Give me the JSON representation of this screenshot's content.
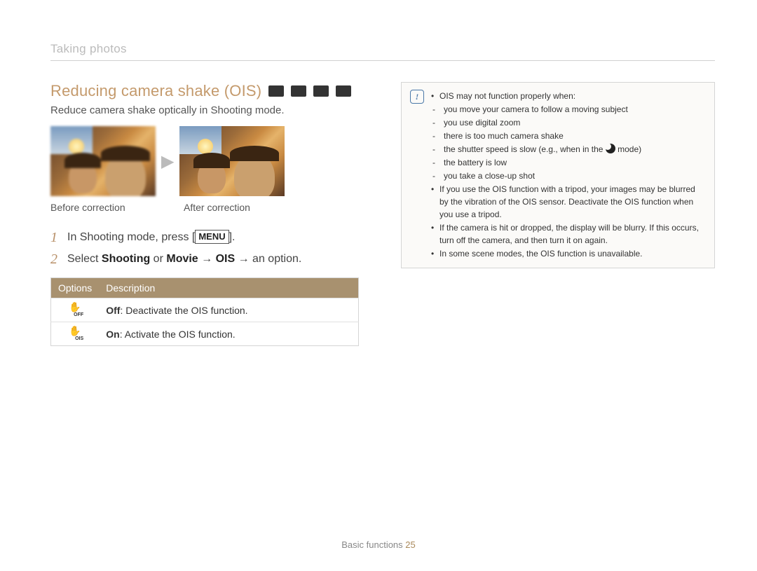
{
  "section_label": "Taking photos",
  "heading": "Reducing camera shake (OIS)",
  "subtitle": "Reduce camera shake optically in Shooting mode.",
  "captions": {
    "before": "Before correction",
    "after": "After correction"
  },
  "steps": [
    {
      "num": "1",
      "pre": "In Shooting mode, press [",
      "bold": "MENU",
      "post": "]."
    },
    {
      "num": "2",
      "text_parts": [
        "Select ",
        "Shooting",
        " or ",
        "Movie",
        " → ",
        "OIS",
        " → an option."
      ]
    }
  ],
  "options_table": {
    "headers": {
      "options": "Options",
      "description": "Description"
    },
    "rows": [
      {
        "icon_tag": "OFF",
        "label": "Off",
        "desc": ": Deactivate the OIS function."
      },
      {
        "icon_tag": "OIS",
        "label": "On",
        "desc": ": Activate the OIS function."
      }
    ]
  },
  "note": {
    "intro": "OIS may not function properly when:",
    "conditions": [
      "you move your camera to follow a moving subject",
      "you use digital zoom",
      "there is too much camera shake",
      "the shutter speed is slow (e.g., when in the ",
      "the battery is low",
      "you take a close-up shot"
    ],
    "condition_shutter_suffix": " mode)",
    "bullets_extra": [
      "If you use the OIS function with a tripod, your images may be blurred by the vibration of the OIS sensor. Deactivate the OIS function when you use a tripod.",
      "If the camera is hit or dropped, the display will be blurry. If this occurs, turn off the camera, and then turn it on again.",
      "In some scene modes, the OIS function is unavailable."
    ]
  },
  "footer": {
    "label": "Basic functions",
    "page": "25"
  }
}
